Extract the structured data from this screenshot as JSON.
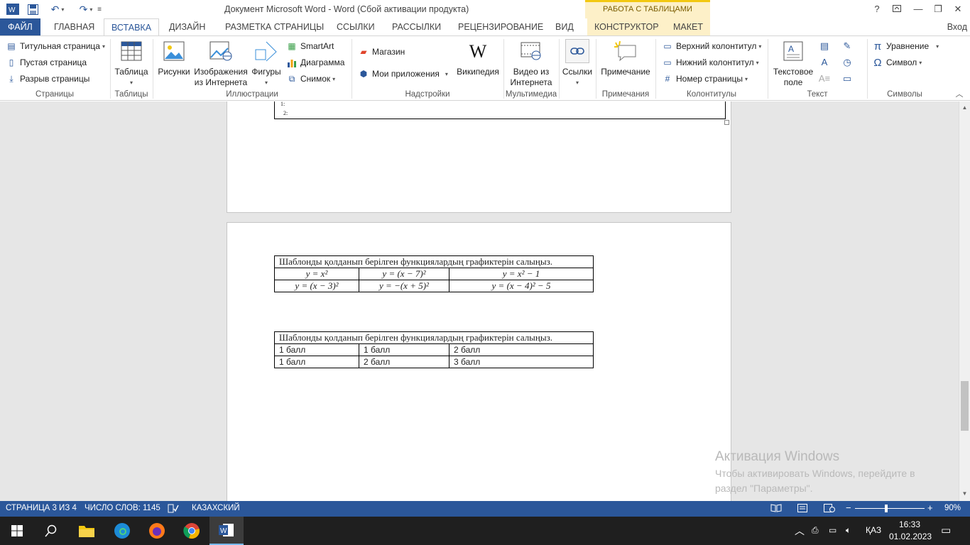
{
  "titlebar": {
    "title": "Документ Microsoft Word - Word (Сбой активации продукта)",
    "context_group": "РАБОТА С ТАБЛИЦАМИ",
    "help": "?"
  },
  "tabs": {
    "file": "ФАЙЛ",
    "home": "ГЛАВНАЯ",
    "insert": "ВСТАВКА",
    "design": "ДИЗАЙН",
    "layout": "РАЗМЕТКА СТРАНИЦЫ",
    "references": "ССЫЛКИ",
    "mailings": "РАССЫЛКИ",
    "review": "РЕЦЕНЗИРОВАНИЕ",
    "view": "ВИД",
    "constructor": "КОНСТРУКТОР",
    "table_layout": "МАКЕТ",
    "signin": "Вход"
  },
  "ribbon": {
    "pages": {
      "cover": "Титульная страница",
      "blank": "Пустая страница",
      "break": "Разрыв страницы",
      "label": "Страницы"
    },
    "tables": {
      "table": "Таблица",
      "label": "Таблицы"
    },
    "illustrations": {
      "pictures": "Рисунки",
      "online_line1": "Изображения",
      "online_line2": "из Интернета",
      "shapes": "Фигуры",
      "smartart": "SmartArt",
      "chart": "Диаграмма",
      "screenshot": "Снимок",
      "label": "Иллюстрации"
    },
    "addins": {
      "store": "Магазин",
      "my_apps": "Мои приложения",
      "wikipedia": "Википедия",
      "label": "Надстройки"
    },
    "media": {
      "video_line1": "Видео из",
      "video_line2": "Интернета",
      "label": "Мультимедиа"
    },
    "links": {
      "links": "Ссылки"
    },
    "comments": {
      "comment": "Примечание",
      "label": "Примечания"
    },
    "header_footer": {
      "header": "Верхний колонтитул",
      "footer": "Нижний колонтитул",
      "page_number": "Номер страницы",
      "label": "Колонтитулы"
    },
    "text": {
      "textbox_line1": "Текстовое",
      "textbox_line2": "поле",
      "label": "Текст"
    },
    "symbols": {
      "equation": "Уравнение",
      "symbol": "Символ",
      "label": "Символы"
    }
  },
  "document": {
    "prev_list": [
      "1:",
      "2:"
    ],
    "table1": {
      "title": "Шаблонды қолданып берілген функциялардың графиктерін салыңыз.",
      "rows": [
        [
          "y = x²",
          "y = (x − 7)²",
          "y = x² − 1"
        ],
        [
          "y = (x − 3)²",
          "y = −(x + 5)²",
          "y = (x − 4)² − 5"
        ]
      ]
    },
    "table2": {
      "title": "Шаблонды қолданып берілген функциялардың графиктерін салыңыз.",
      "rows": [
        [
          "1 балл",
          "1 балл",
          "2 балл"
        ],
        [
          "1 балл",
          "2 балл",
          "3 балл"
        ]
      ]
    }
  },
  "watermark": {
    "title": "Активация Windows",
    "text": "Чтобы активировать Windows, перейдите в раздел \"Параметры\"."
  },
  "statusbar": {
    "page": "СТРАНИЦА 3 ИЗ 4",
    "words": "ЧИСЛО СЛОВ: 1145",
    "language": "КАЗАХСКИЙ",
    "zoom": "90%",
    "zoom_minus": "−",
    "zoom_plus": "+"
  },
  "taskbar": {
    "lang": "ҚАЗ",
    "time": "16:33",
    "date": "01.02.2023"
  },
  "colors": {
    "accent": "#2b579a",
    "context": "#fdf0c8",
    "doc_bg": "#e6e6e6"
  }
}
